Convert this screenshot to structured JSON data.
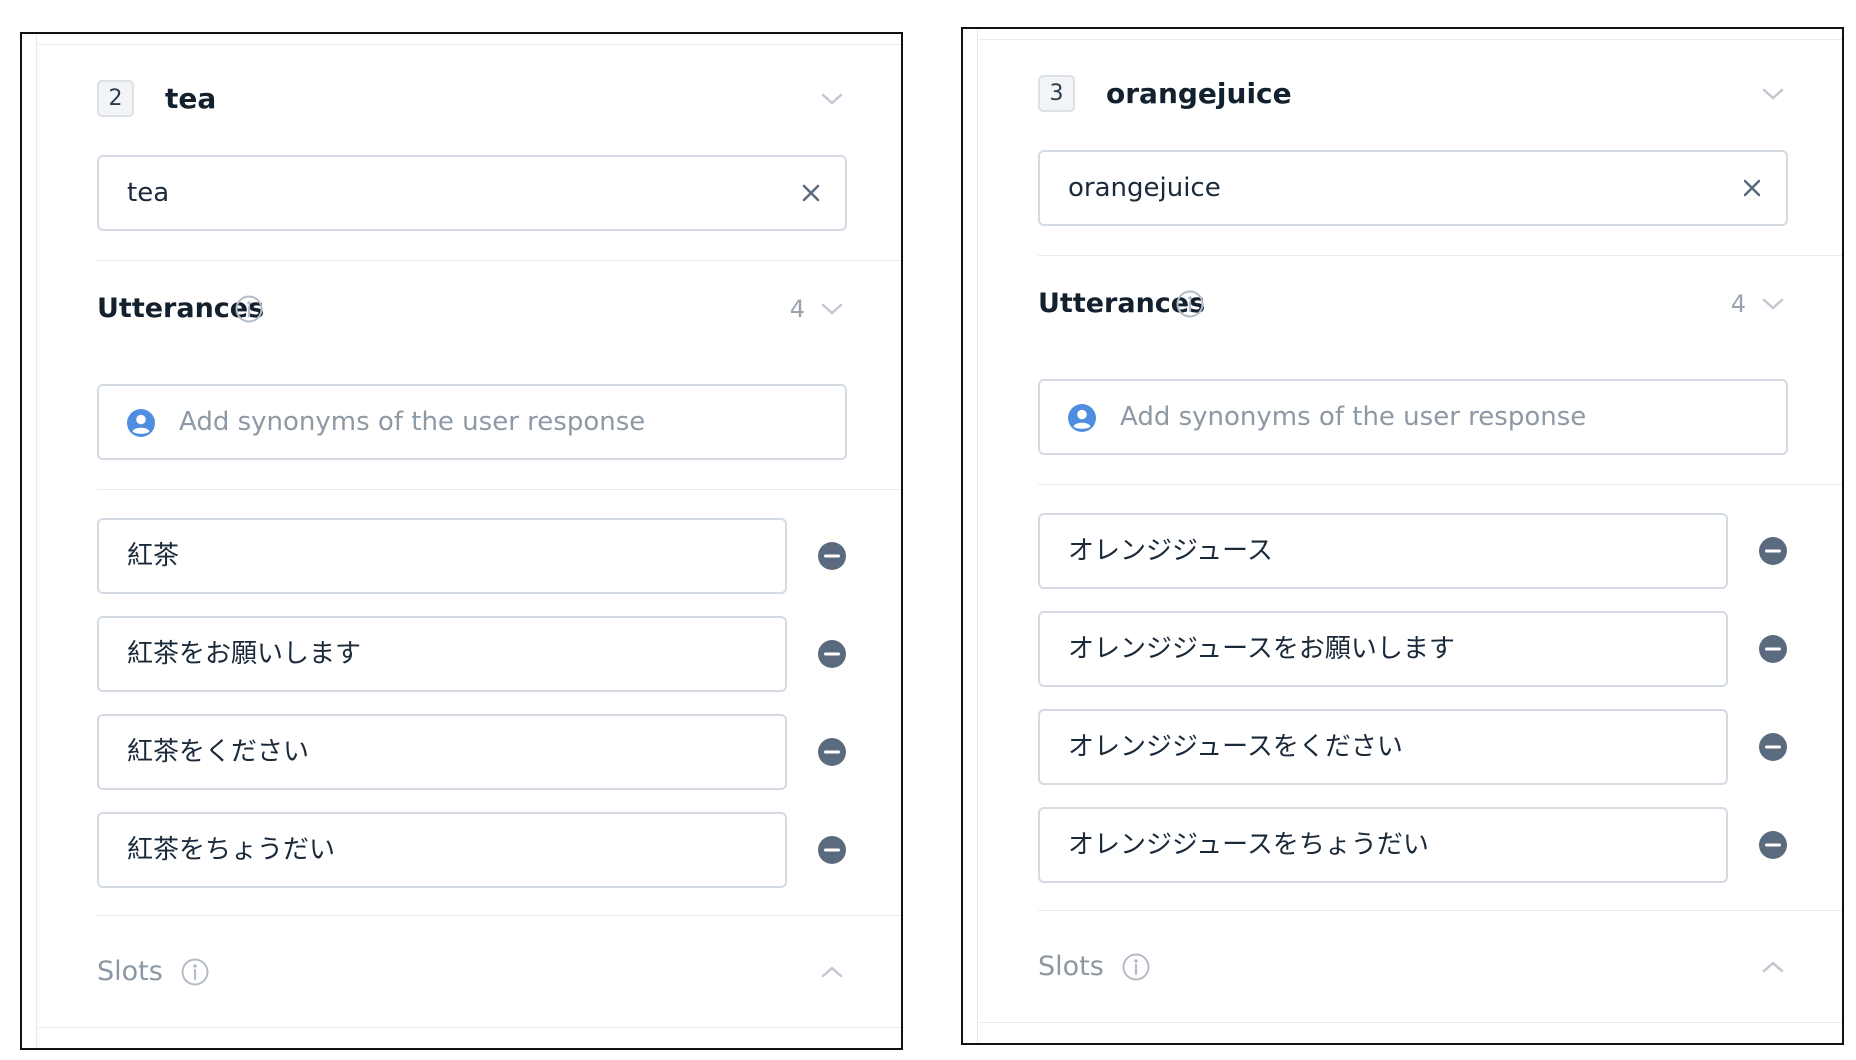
{
  "panels": [
    {
      "index": "2",
      "name": "tea",
      "value": "tea",
      "utterances_title": "Utterances",
      "utterances_count": "4",
      "add_placeholder": "Add synonyms of the user response",
      "utterances": [
        "紅茶",
        "紅茶をお願いします",
        "紅茶をください",
        "紅茶をちょうだい"
      ],
      "slots_title": "Slots"
    },
    {
      "index": "3",
      "name": "orangejuice",
      "value": "orangejuice",
      "utterances_title": "Utterances",
      "utterances_count": "4",
      "add_placeholder": "Add synonyms of the user response",
      "utterances": [
        "オレンジジュース",
        "オレンジジュースをお願いします",
        "オレンジジュースをください",
        "オレンジジュースをちょうだい"
      ],
      "slots_title": "Slots"
    }
  ],
  "colors": {
    "icon": "#5a6b80",
    "user_icon": "#4f8de0",
    "border": "#d5dbe3"
  }
}
